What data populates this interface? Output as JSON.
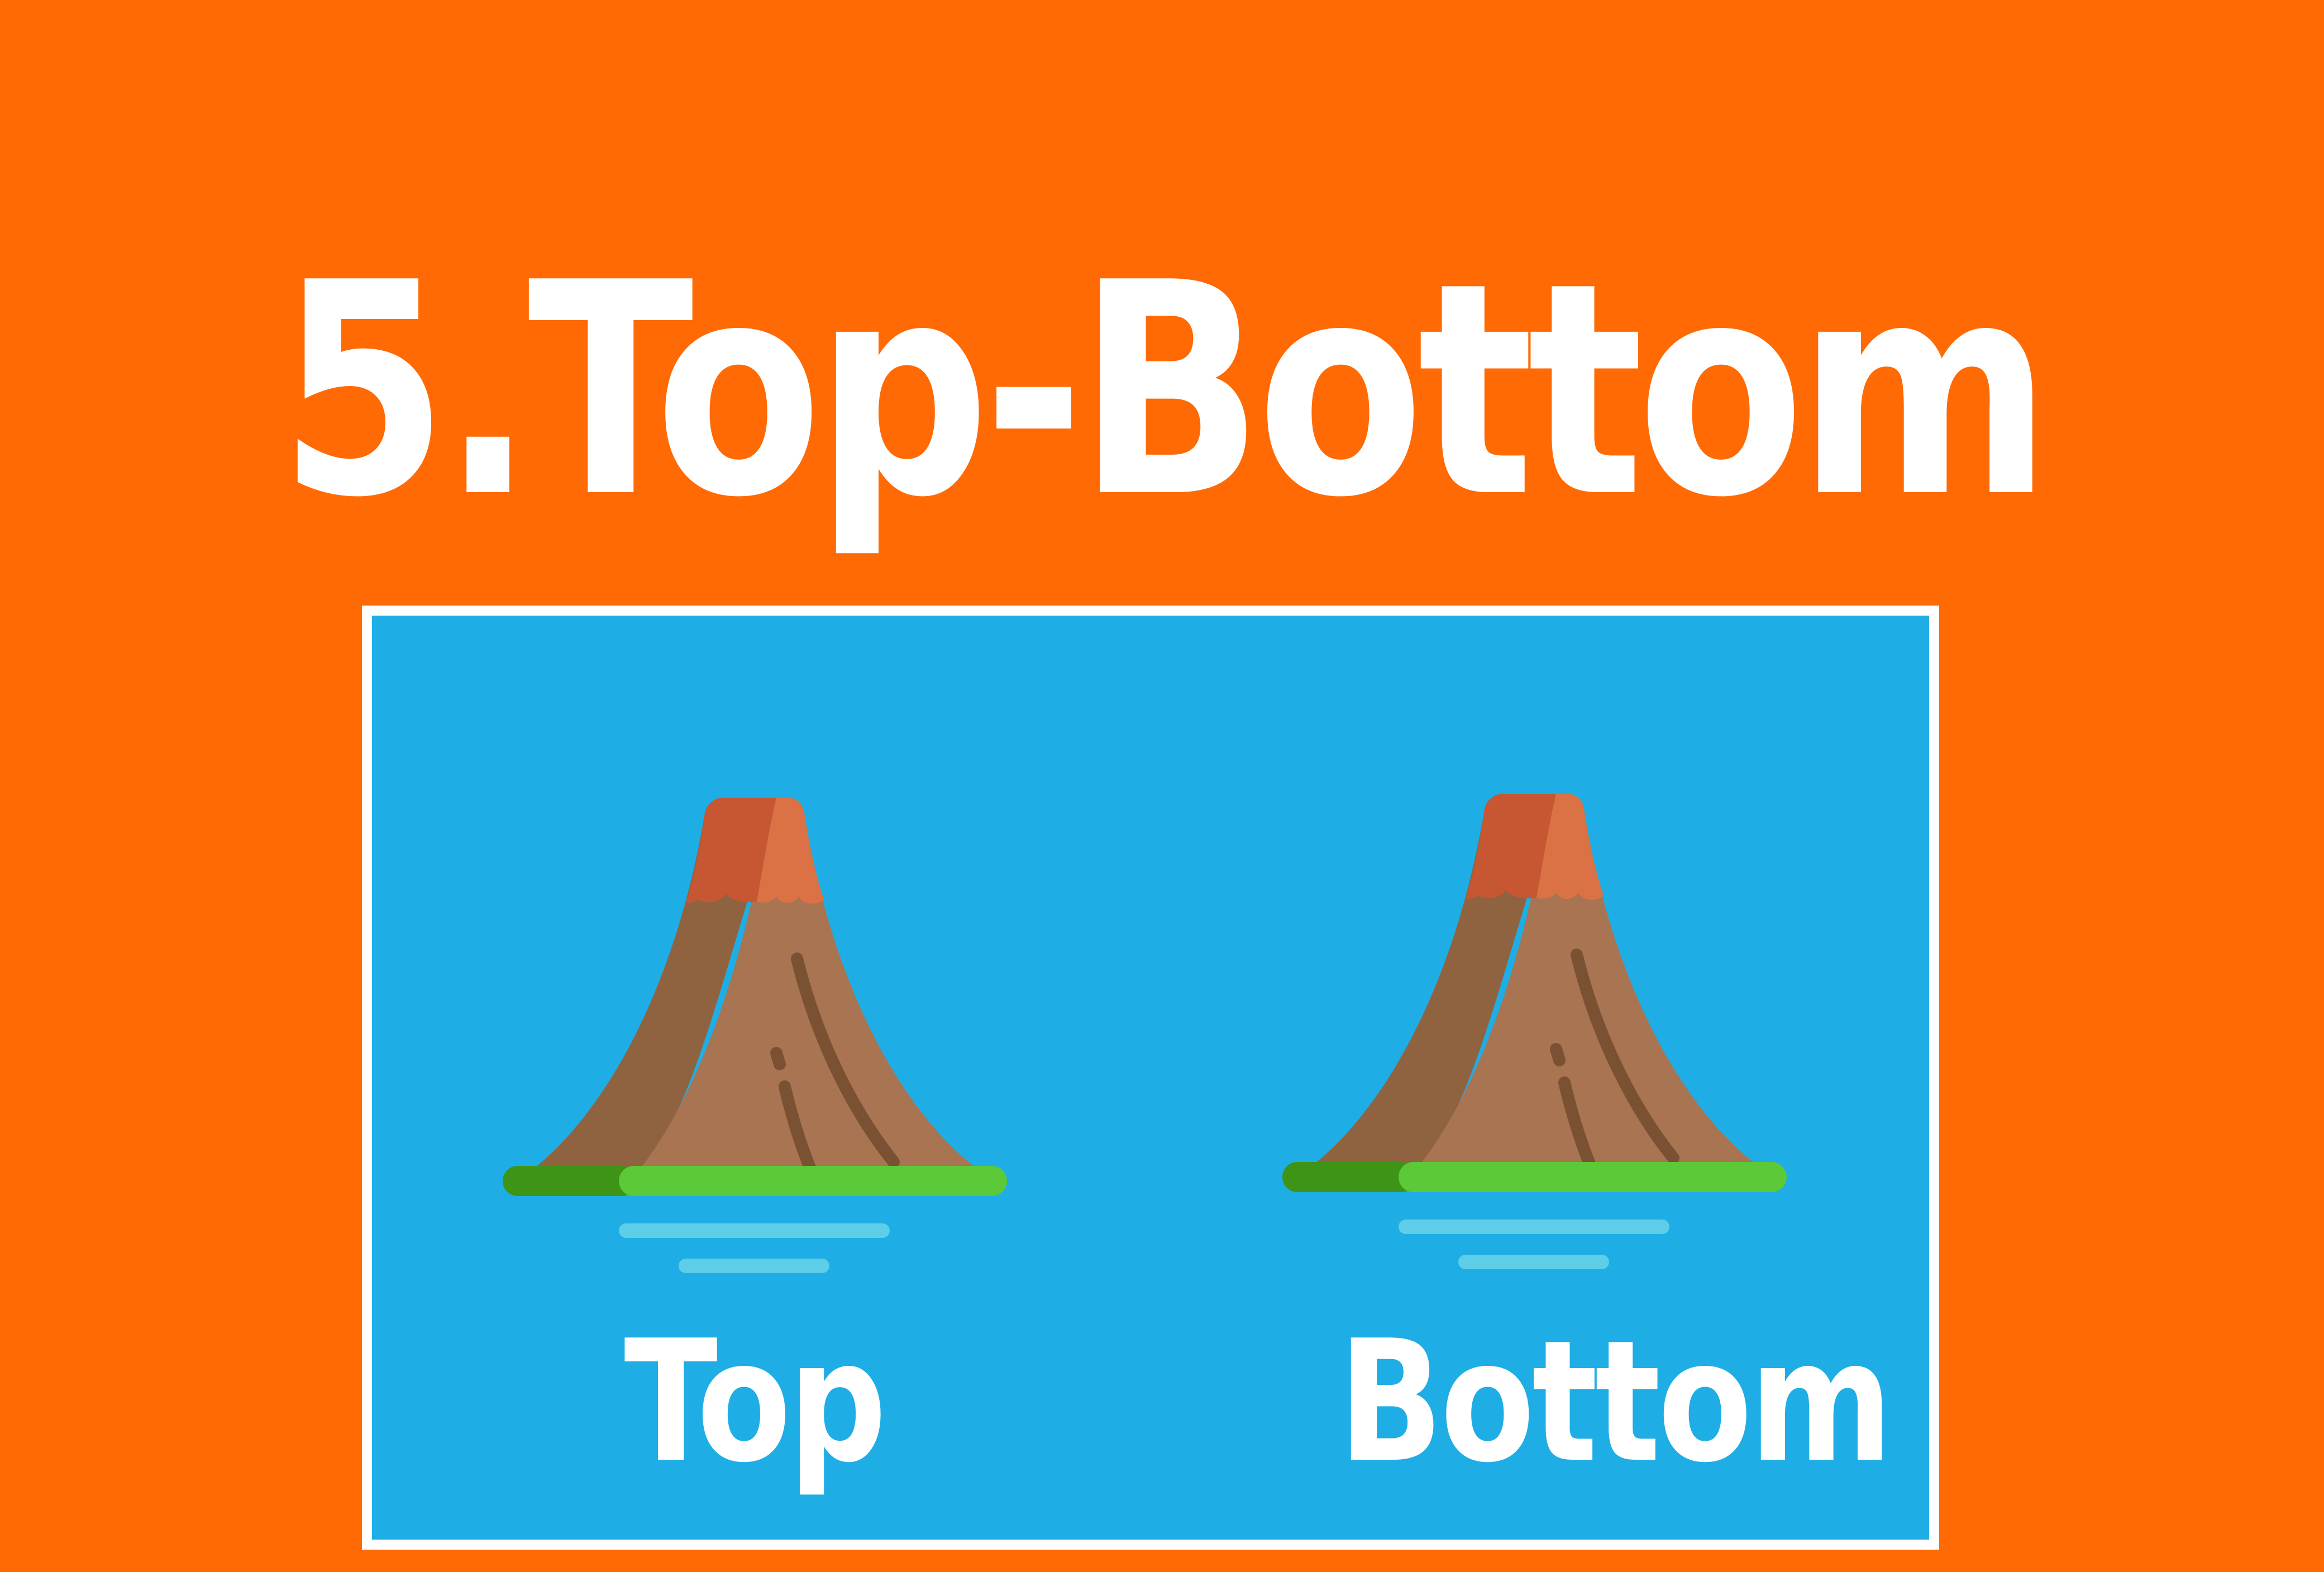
{
  "page": {
    "title": "5.Top-Bottom",
    "captions": {
      "left": "Top",
      "right": "Bottom"
    }
  },
  "colors": {
    "background": "#FF6A04",
    "panel": "#1EAEE5",
    "panel_border": "#FFFFFF",
    "text": "#FFFFFF",
    "mountain_shadow": "#906340",
    "mountain_light": "#A87452",
    "crater_dark": "#C65732",
    "crater_light": "#DB7245",
    "crack": "#7A5233",
    "grass_dark": "#3E9416",
    "grass_light": "#5BC938",
    "water": "#5DCDE8"
  },
  "icons": {
    "left": "volcano-island-icon",
    "right": "volcano-island-icon"
  }
}
